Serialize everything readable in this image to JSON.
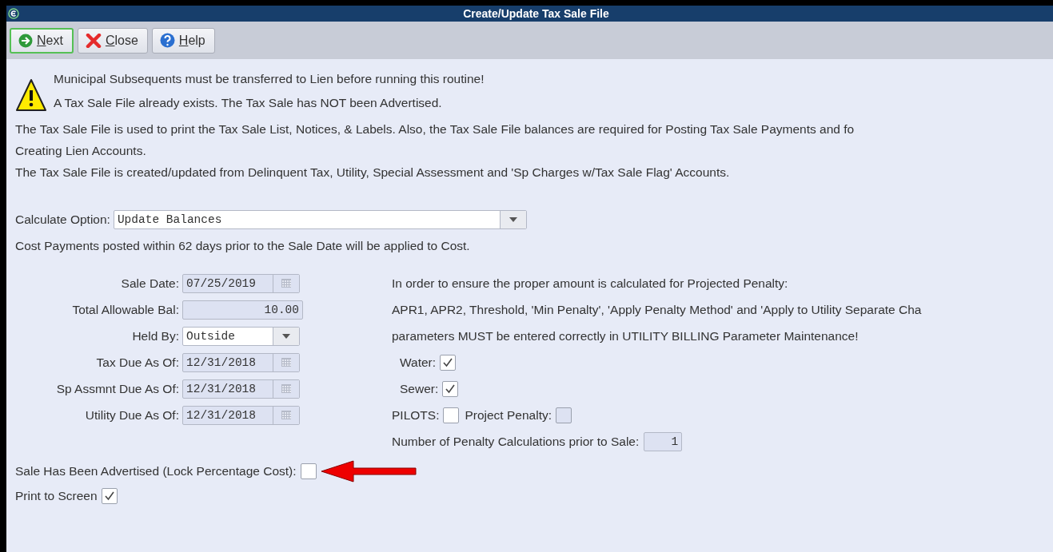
{
  "window": {
    "title": "Create/Update Tax Sale File"
  },
  "toolbar": [
    {
      "kind": "next",
      "label": "Next",
      "focused": true
    },
    {
      "kind": "close",
      "label": "Close",
      "focused": false
    },
    {
      "kind": "help",
      "label": "Help",
      "focused": false
    }
  ],
  "warnings": [
    "Municipal Subsequents must be transferred to Lien before running this routine!",
    "A Tax Sale File already exists.  The Tax Sale has NOT been Advertised."
  ],
  "info": [
    "The Tax Sale File is used to print the Tax Sale List, Notices, & Labels.  Also, the Tax Sale File balances are required for Posting Tax Sale Payments and fo",
    "Creating Lien Accounts.",
    "The Tax Sale File is created/updated from Delinquent Tax, Utility, Special Assessment and 'Sp Charges w/Tax Sale Flag' Accounts."
  ],
  "calculate_option": {
    "label": "Calculate Option:",
    "value": "Update Balances"
  },
  "cost_note": "Cost Payments posted within 62 days prior to the Sale Date will be applied to Cost.",
  "fields": [
    {
      "kind": "date",
      "label": "Sale Date:",
      "value": "07/25/2019",
      "disabled": true
    },
    {
      "kind": "number",
      "label": "Total Allowable Bal:",
      "value": "10.00",
      "disabled": true
    },
    {
      "kind": "select",
      "label": "Held By:",
      "value": "Outside",
      "disabled": false
    },
    {
      "kind": "date",
      "label": "Tax Due As Of:",
      "value": "12/31/2018",
      "disabled": true
    },
    {
      "kind": "date",
      "label": "Sp Assmnt Due As Of:",
      "value": "12/31/2018",
      "disabled": true
    },
    {
      "kind": "date",
      "label": "Utility Due As Of:",
      "value": "12/31/2018",
      "disabled": true
    }
  ],
  "penalty_notes": [
    "In order to ensure the proper amount is calculated for Projected Penalty:",
    "APR1, APR2, Threshold, 'Min Penalty', 'Apply Penalty Method' and 'Apply to Utility Separate Cha",
    "parameters MUST be entered correctly in UTILITY BILLING Parameter Maintenance!"
  ],
  "utility_checks": [
    {
      "label": "Water:",
      "checked": true,
      "disabled": false
    },
    {
      "label": "Sewer:",
      "checked": true,
      "disabled": false
    }
  ],
  "pilots": {
    "label": "PILOTS:",
    "checked": false,
    "disabled": false
  },
  "project_penalty": {
    "label": "Project Penalty:",
    "checked": false,
    "disabled": true
  },
  "penalty_calcs": {
    "label": "Number of Penalty Calculations prior to Sale:",
    "value": "1"
  },
  "advertised": {
    "label": "Sale Has Been Advertised (Lock Percentage Cost):",
    "checked": false,
    "disabled": false
  },
  "print_to_screen": {
    "label": "Print to Screen",
    "checked": true,
    "disabled": false
  }
}
